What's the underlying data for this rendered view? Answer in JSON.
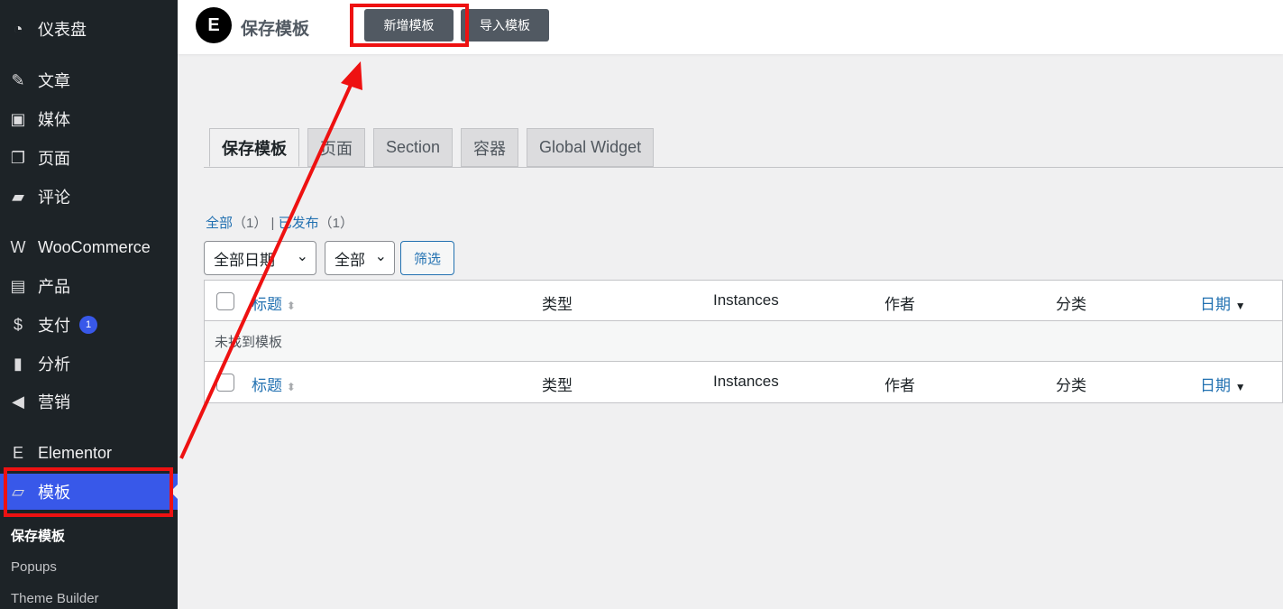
{
  "sidebar": {
    "items": [
      {
        "label": "仪表盘",
        "icon": "dashboard-icon",
        "glyph": "◔"
      },
      {
        "label": "文章",
        "icon": "pin-icon",
        "glyph": "✎"
      },
      {
        "label": "媒体",
        "icon": "media-icon",
        "glyph": "▣"
      },
      {
        "label": "页面",
        "icon": "page-icon",
        "glyph": "❐"
      },
      {
        "label": "评论",
        "icon": "comment-icon",
        "glyph": "▰"
      },
      {
        "label": "WooCommerce",
        "icon": "woocommerce-icon",
        "glyph": "W"
      },
      {
        "label": "产品",
        "icon": "archive-icon",
        "glyph": "▤"
      },
      {
        "label": "支付",
        "icon": "payment-icon",
        "glyph": "$",
        "badge": "1"
      },
      {
        "label": "分析",
        "icon": "chart-icon",
        "glyph": "▮"
      },
      {
        "label": "营销",
        "icon": "megaphone-icon",
        "glyph": "◀"
      },
      {
        "label": "Elementor",
        "icon": "elementor-icon",
        "glyph": "E"
      },
      {
        "label": "模板",
        "icon": "folder-icon",
        "glyph": "▱"
      }
    ],
    "sub": [
      "保存模板",
      "Popups",
      "Theme Builder"
    ]
  },
  "header": {
    "title": "保存模板",
    "add_label": "新增模板",
    "import_label": "导入模板"
  },
  "tabs": [
    "保存模板",
    "页面",
    "Section",
    "容器",
    "Global Widget"
  ],
  "views": {
    "all": "全部",
    "all_count": "（1）",
    "sep": "|",
    "published": "已发布",
    "published_count": "（1）"
  },
  "filters": {
    "date": "全部日期",
    "type": "全部",
    "submit": "筛选"
  },
  "table": {
    "columns": [
      "标题",
      "类型",
      "Instances",
      "作者",
      "分类",
      "日期"
    ],
    "empty": "未找到模板"
  },
  "colors": {
    "accent": "#3858e9",
    "annotation": "#ee1111",
    "link": "#2271b1"
  }
}
